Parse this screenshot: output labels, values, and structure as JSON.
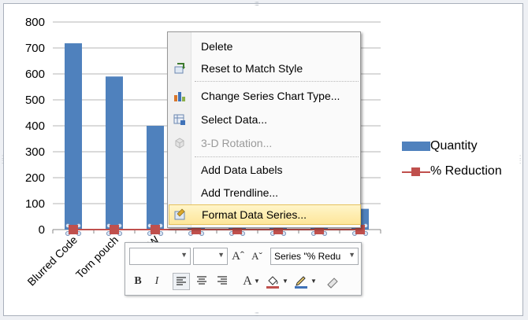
{
  "chart_data": {
    "type": "bar",
    "categories": [
      "Blurred Code",
      "Torn pouch",
      "W",
      "",
      "",
      "",
      "",
      ""
    ],
    "visible_category_labels": [
      "Blurred Code",
      "Torn pouch",
      "W"
    ],
    "series": [
      {
        "name": "Quantity",
        "kind": "bar",
        "color": "#4f81bd",
        "values": [
          718,
          590,
          400,
          80,
          80,
          80,
          80,
          80
        ]
      },
      {
        "name": "% Reduction",
        "kind": "line",
        "color": "#c0504d",
        "values": [
          0,
          0,
          0,
          0,
          0,
          0,
          0,
          0
        ]
      }
    ],
    "yticks": [
      "0",
      "100",
      "200",
      "300",
      "400",
      "500",
      "600",
      "700",
      "800"
    ],
    "ylim": [
      0,
      800
    ],
    "grid": true,
    "legend": "right"
  },
  "legend": {
    "items": [
      {
        "label": "Quantity",
        "style": "bar"
      },
      {
        "label": "% Reduction",
        "style": "line-marker"
      }
    ]
  },
  "context_menu": {
    "items": [
      {
        "label": "Delete",
        "icon": "",
        "enabled": true
      },
      {
        "label": "Reset to Match Style",
        "icon": "reset-style-icon",
        "enabled": true
      },
      {
        "label": "Change Series Chart Type...",
        "icon": "chart-type-icon",
        "enabled": true
      },
      {
        "label": "Select Data...",
        "icon": "select-data-icon",
        "enabled": true
      },
      {
        "label": "3-D Rotation...",
        "icon": "3d-rotation-icon",
        "enabled": false
      },
      {
        "label": "Add Data Labels",
        "icon": "",
        "enabled": true
      },
      {
        "label": "Add Trendline...",
        "icon": "",
        "enabled": true
      },
      {
        "label": "Format Data Series...",
        "icon": "format-series-icon",
        "enabled": true,
        "highlighted": true
      }
    ]
  },
  "mini_toolbar": {
    "font_name": "",
    "font_size": "",
    "grow_font": "Aˆ",
    "shrink_font": "Aˇ",
    "chart_element": "Series \"% Redu",
    "bold": "B",
    "italic": "I",
    "font_color_glyph": "A"
  }
}
